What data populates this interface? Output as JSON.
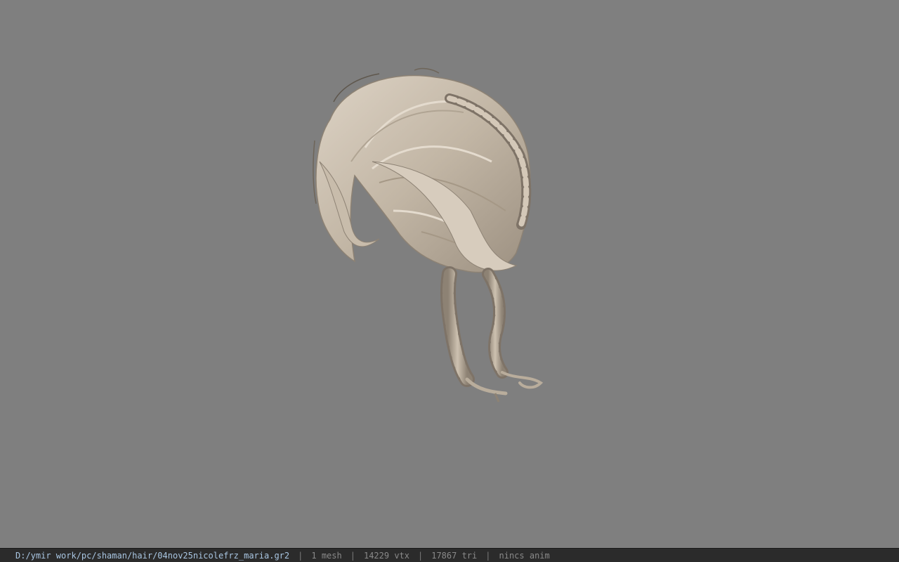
{
  "viewport": {
    "background": "#7f7f7f",
    "model": {
      "description_icon": "hair-mesh-icon",
      "hair_color": "#c2b6a5",
      "hair_shadow": "#8d8274",
      "hair_highlight": "#ddd3c5"
    }
  },
  "statusbar": {
    "file_path": "D:/ymir work/pc/shaman/hair/04nov25nicolefrz_maria.gr2",
    "sep": "|",
    "mesh_count": "1 mesh",
    "vertex_count": "14229 vtx",
    "triangle_count": "17867 tri",
    "anim_status": "nincs anim",
    "path_color": "#a9c6e2",
    "text_color": "#8a8a8a",
    "background": "#2b2b2b"
  }
}
